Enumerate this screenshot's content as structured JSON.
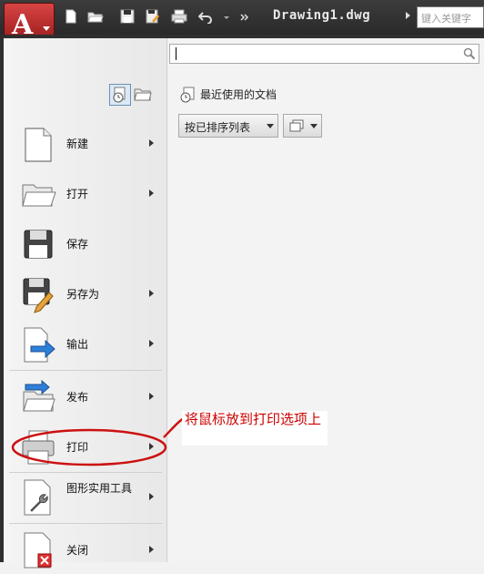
{
  "titlebar": {
    "title": "Drawing1.dwg",
    "keyword_search_placeholder": "键入关键字"
  },
  "search": {
    "value": ""
  },
  "recent": {
    "header": "最近使用的文档",
    "sort_dropdown": "按已排序列表"
  },
  "menu": {
    "items": [
      {
        "label": "新建",
        "has_submenu": true
      },
      {
        "label": "打开",
        "has_submenu": true
      },
      {
        "label": "保存",
        "has_submenu": false
      },
      {
        "label": "另存为",
        "has_submenu": true
      },
      {
        "label": "输出",
        "has_submenu": true
      },
      {
        "label": "发布",
        "has_submenu": true
      },
      {
        "label": "打印",
        "has_submenu": true
      },
      {
        "label": "图形实用工具",
        "has_submenu": true
      },
      {
        "label": "关闭",
        "has_submenu": true
      }
    ]
  },
  "annotation": {
    "text": "将鼠标放到打印选项上",
    "color": "#cc0000"
  },
  "colors": {
    "app_button": "#c62f2f",
    "titlebar": "#333333"
  }
}
